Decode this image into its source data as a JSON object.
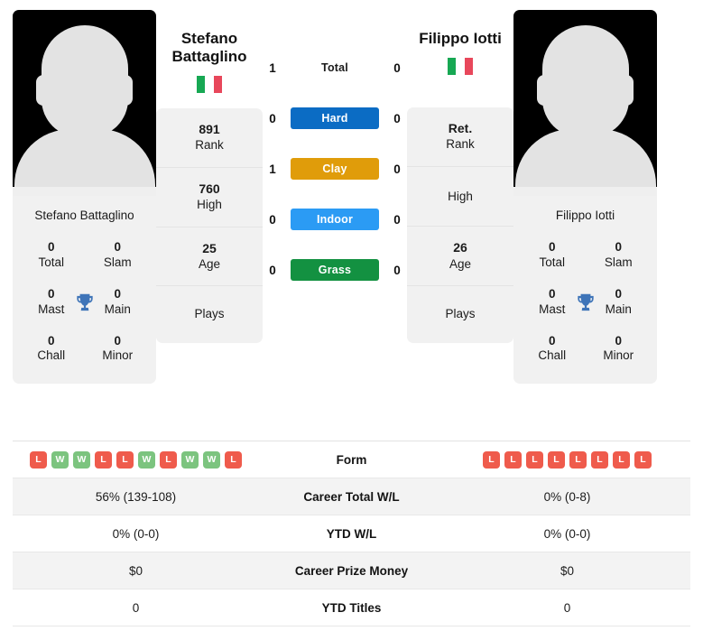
{
  "players": {
    "left": {
      "first_name": "Stefano",
      "last_name": "Battaglino",
      "full_name": "Stefano Battaglino",
      "country": "Italy",
      "flag_icon": "italy-flag-icon",
      "avatar_icon": "player-avatar-placeholder-icon",
      "titles": {
        "total_value": "0",
        "total_label": "Total",
        "slam_value": "0",
        "slam_label": "Slam",
        "mast_value": "0",
        "mast_label": "Mast",
        "main_value": "0",
        "main_label": "Main",
        "chall_value": "0",
        "chall_label": "Chall",
        "minor_value": "0",
        "minor_label": "Minor",
        "trophy_icon": "trophy-icon"
      },
      "stats": [
        {
          "value": "891",
          "label": "Rank"
        },
        {
          "value": "760",
          "label": "High"
        },
        {
          "value": "25",
          "label": "Age"
        },
        {
          "value": "",
          "label": "Plays"
        }
      ],
      "form": [
        "L",
        "W",
        "W",
        "L",
        "L",
        "W",
        "L",
        "W",
        "W",
        "L"
      ],
      "career_total_wl": "56% (139-108)",
      "ytd_wl": "0% (0-0)",
      "career_prize_money": "$0",
      "ytd_titles": "0"
    },
    "right": {
      "first_name": "Filippo",
      "last_name": "Iotti",
      "full_name": "Filippo Iotti",
      "country": "Italy",
      "flag_icon": "italy-flag-icon",
      "avatar_icon": "player-avatar-placeholder-icon",
      "titles": {
        "total_value": "0",
        "total_label": "Total",
        "slam_value": "0",
        "slam_label": "Slam",
        "mast_value": "0",
        "mast_label": "Mast",
        "main_value": "0",
        "main_label": "Main",
        "chall_value": "0",
        "chall_label": "Chall",
        "minor_value": "0",
        "minor_label": "Minor",
        "trophy_icon": "trophy-icon"
      },
      "stats": [
        {
          "value": "Ret.",
          "label": "Rank"
        },
        {
          "value": "",
          "label": "High"
        },
        {
          "value": "26",
          "label": "Age"
        },
        {
          "value": "",
          "label": "Plays"
        }
      ],
      "form": [
        "L",
        "L",
        "L",
        "L",
        "L",
        "L",
        "L",
        "L"
      ],
      "career_total_wl": "0% (0-8)",
      "ytd_wl": "0% (0-0)",
      "career_prize_money": "$0",
      "ytd_titles": "0"
    }
  },
  "head_to_head": [
    {
      "label": "Total",
      "left": "1",
      "right": "0",
      "color": "",
      "style": "plain"
    },
    {
      "label": "Hard",
      "left": "0",
      "right": "0",
      "color": "#0b6cc4",
      "style": "surface"
    },
    {
      "label": "Clay",
      "left": "1",
      "right": "0",
      "color": "#e09c0a",
      "style": "surface"
    },
    {
      "label": "Indoor",
      "left": "0",
      "right": "0",
      "color": "#2b9bf4",
      "style": "surface"
    },
    {
      "label": "Grass",
      "left": "0",
      "right": "0",
      "color": "#139141",
      "style": "surface"
    }
  ],
  "table_rows": [
    {
      "label": "Form",
      "type": "form"
    },
    {
      "label": "Career Total W/L",
      "type": "text",
      "key": "career_total_wl"
    },
    {
      "label": "YTD W/L",
      "type": "text",
      "key": "ytd_wl"
    },
    {
      "label": "Career Prize Money",
      "type": "text",
      "key": "career_prize_money"
    },
    {
      "label": "YTD Titles",
      "type": "text",
      "key": "ytd_titles"
    }
  ],
  "colors": {
    "hard": "#0b6cc4",
    "clay": "#e09c0a",
    "indoor": "#2b9bf4",
    "grass": "#139141",
    "win_badge": "#7cc47f",
    "loss_badge": "#ef5b4c",
    "card_bg": "#f1f1f1",
    "row_alt_bg": "#f3f3f3"
  }
}
